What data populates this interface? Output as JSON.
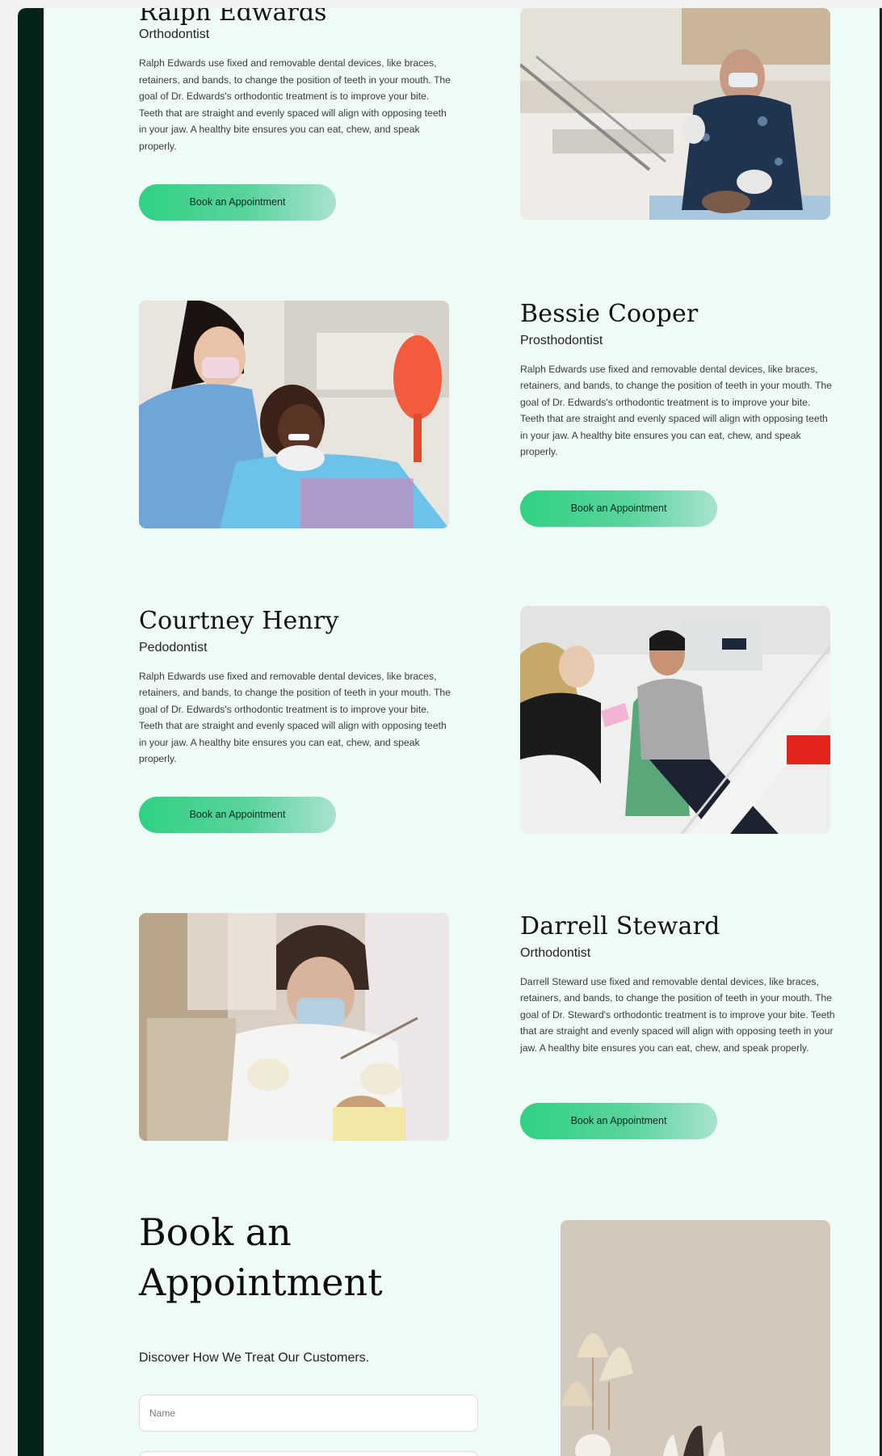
{
  "doctors": [
    {
      "name": "Ralph Edwards",
      "role": "Orthodontist",
      "desc": "Ralph Edwards use fixed and removable dental devices, like braces, retainers, and bands, to change the position of teeth in your mouth. The goal of Dr. Edwards's orthodontic treatment is to improve your bite. Teeth that are straight and evenly spaced will align with opposing teeth in your jaw. A healthy bite ensures you can eat, chew, and speak properly.",
      "button": "Book an Appointment"
    },
    {
      "name": "Bessie Cooper",
      "role": "Prosthodontist",
      "desc": "Ralph Edwards use fixed and removable dental devices, like braces, retainers, and bands, to change the position of teeth in your mouth. The goal of Dr. Edwards's orthodontic treatment is to improve your bite. Teeth that are straight and evenly spaced will align with opposing teeth in your jaw. A healthy bite ensures you can eat, chew, and speak properly.",
      "button": "Book an Appointment"
    },
    {
      "name": "Courtney Henry",
      "role": "Pedodontist",
      "desc": "Ralph Edwards use fixed and removable dental devices, like braces, retainers, and bands, to change the position of teeth in your mouth. The goal of Dr. Edwards's orthodontic treatment is to improve your bite. Teeth that are straight and evenly spaced will align with opposing teeth in your jaw. A healthy bite ensures you can eat, chew, and speak properly.",
      "button": "Book an Appointment"
    },
    {
      "name": "Darrell Steward",
      "role": "Orthodontist",
      "desc": "Darrell Steward use fixed and removable dental devices, like braces, retainers, and bands, to change the position of teeth in your mouth. The goal of Dr. Steward's orthodontic treatment is to improve your bite. Teeth that are straight and evenly spaced will align with opposing teeth in your jaw. A healthy bite ensures you can eat, chew, and speak properly.",
      "button": "Book an Appointment"
    }
  ],
  "booking": {
    "title_line1": "Book an",
    "title_line2": "Appointment",
    "subtitle": "Discover How We Treat Our Customers.",
    "name_placeholder": "Name"
  },
  "colors": {
    "page_bg": "#effbf7",
    "frame_dark": "#05221b",
    "button_green": "#2fd283"
  }
}
